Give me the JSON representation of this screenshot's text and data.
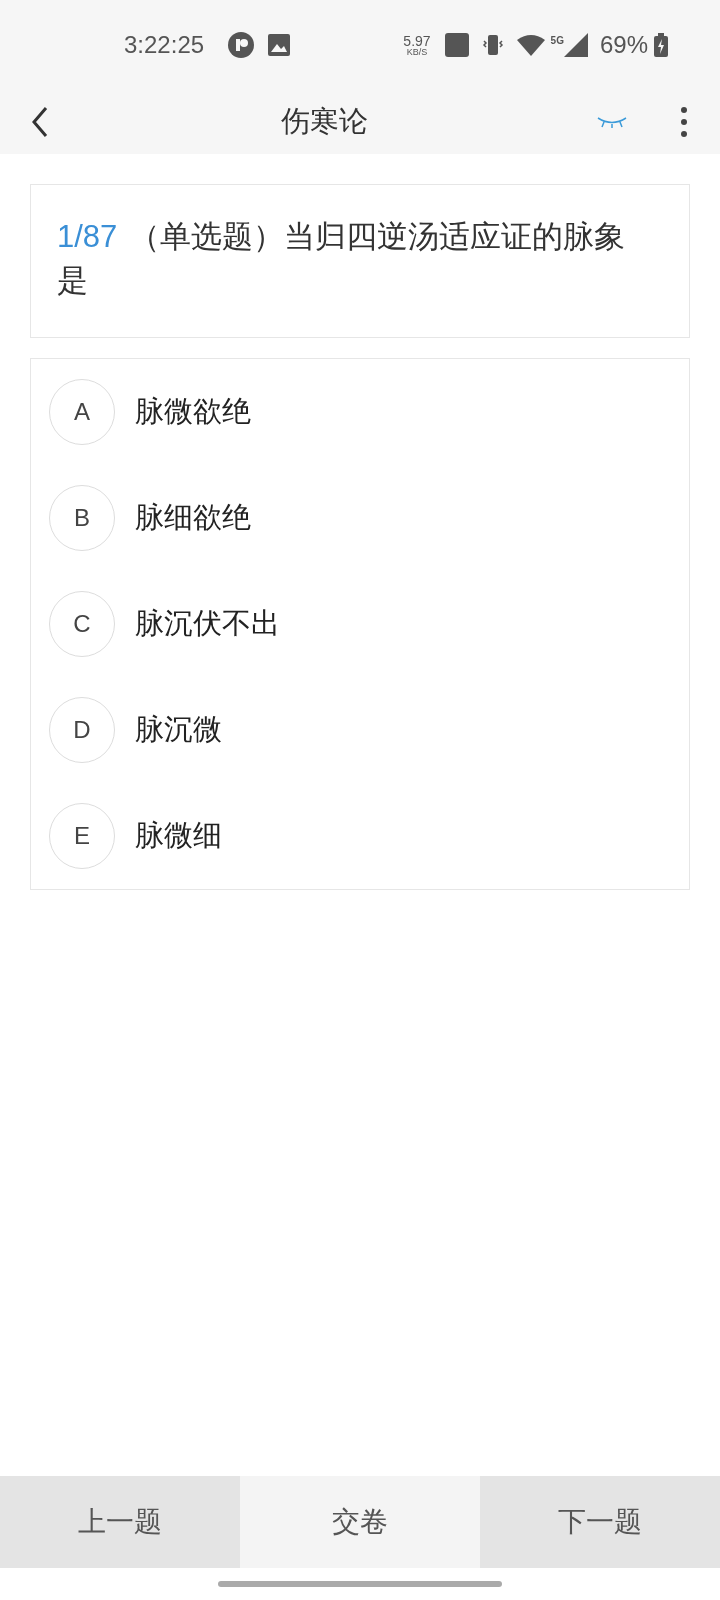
{
  "status_bar": {
    "time": "3:22:25",
    "net_speed": "5.97",
    "net_unit": "KB/S",
    "network": "5G",
    "battery": "69%"
  },
  "header": {
    "title": "伤寒论"
  },
  "question": {
    "number": "1/87",
    "text": "（单选题）当归四逆汤适应证的脉象是"
  },
  "options": [
    {
      "letter": "A",
      "text": "脉微欲绝",
      "selected": false
    },
    {
      "letter": "B",
      "text": "脉细欲绝",
      "selected": false
    },
    {
      "letter": "C",
      "text": "脉沉伏不出",
      "selected": false
    },
    {
      "letter": "D",
      "text": "脉沉微",
      "selected": false
    },
    {
      "letter": "E",
      "text": "脉微细",
      "selected": false
    }
  ],
  "bottom_bar": [
    {
      "label": "上一题",
      "kind": "nav"
    },
    {
      "label": "交卷",
      "kind": "submit"
    },
    {
      "label": "下一题",
      "kind": "nav"
    }
  ]
}
